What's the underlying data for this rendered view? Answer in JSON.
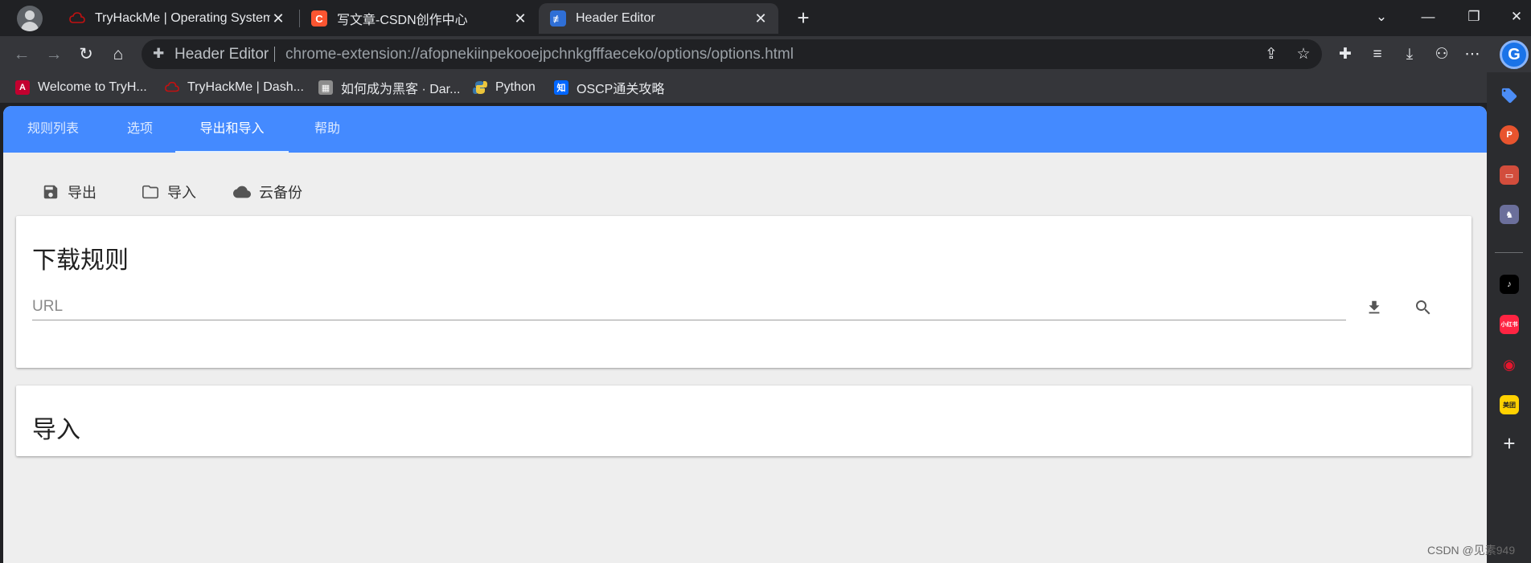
{
  "tabs": [
    {
      "title": "TryHackMe | Operating System",
      "favicon": "tryhackme-cloud-icon"
    },
    {
      "title": "写文章-CSDN创作中心",
      "favicon": "csdn-icon"
    },
    {
      "title": "Header Editor",
      "favicon": "header-editor-icon"
    }
  ],
  "address_bar": {
    "label": "Header Editor",
    "url": "chrome-extension://afopnekiinpekooejpchnkgfffaeceko/options/options.html"
  },
  "bookmarks": [
    {
      "label": "Welcome to TryH...",
      "icon": "angular-icon"
    },
    {
      "label": "TryHackMe | Dash...",
      "icon": "tryhackme-cloud-icon"
    },
    {
      "label": "如何成为黑客 · Dar...",
      "icon": "image-icon"
    },
    {
      "label": "Python",
      "icon": "python-icon"
    },
    {
      "label": "OSCP通关攻略",
      "icon": "zhihu-icon"
    }
  ],
  "app_nav": {
    "tabs": [
      "规则列表",
      "选项",
      "导出和导入",
      "帮助"
    ],
    "active": "导出和导入"
  },
  "actions": {
    "export": "导出",
    "import": "导入",
    "cloud_backup": "云备份"
  },
  "download_card": {
    "title": "下载规则",
    "url_placeholder": "URL"
  },
  "import_card": {
    "title": "导入"
  },
  "sidebar": {
    "items": [
      "tag-icon",
      "office-icon",
      "toolbox-icon",
      "games-icon",
      "tiktok-icon",
      "xiaohongshu-icon",
      "weibo-icon",
      "meituan-icon"
    ],
    "xiaohongshu_label": "小红书",
    "meituan_label": "美团"
  },
  "watermark": "CSDN @见素949",
  "colors": {
    "app_nav": "#448aff",
    "page_bg": "#eeeeee",
    "browser_frame": "#35363a"
  }
}
